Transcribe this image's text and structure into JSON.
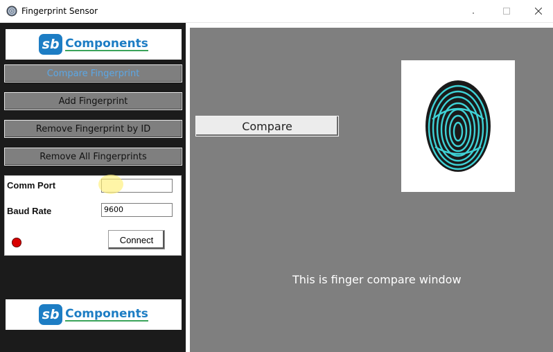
{
  "window": {
    "title": "Fingerprint Sensor",
    "icon": "fingerprint-app-icon",
    "controls": {
      "minimize": "minimize-icon",
      "maximize": "maximize-icon",
      "close": "close-icon"
    }
  },
  "sidebar": {
    "logo": {
      "mark": "sb",
      "text": "Components"
    },
    "buttons": [
      {
        "label": "Compare Fingerprint",
        "active": true
      },
      {
        "label": "Add Fingerprint"
      },
      {
        "label": "Remove Fingerprint by ID"
      },
      {
        "label": "Remove All Fingerprints"
      }
    ],
    "connection": {
      "comm_port_label": "Comm Port",
      "comm_port_value": "",
      "baud_rate_label": "Baud Rate",
      "baud_rate_value": "9600",
      "connect_label": "Connect",
      "status_color": "#d90000"
    }
  },
  "main": {
    "compare_label": "Compare",
    "caption": "This is finger compare window",
    "fingerprint_icon": "fingerprint-image",
    "colors": {
      "background": "#7f7f7f",
      "fingerprint": "#3fd2d6"
    }
  }
}
